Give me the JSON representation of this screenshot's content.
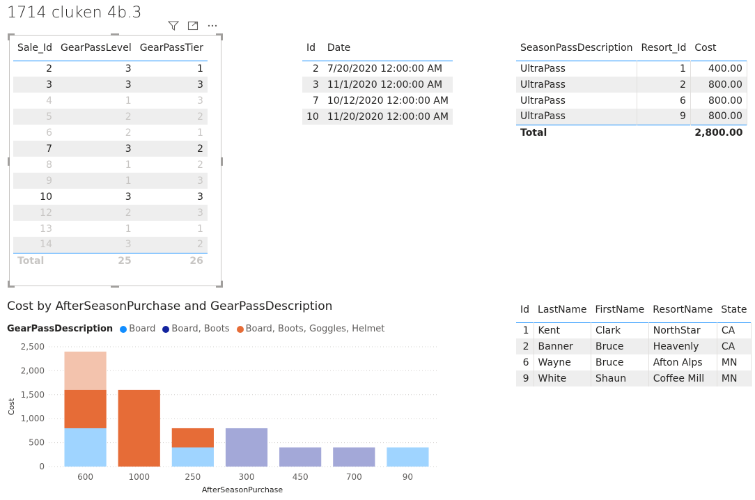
{
  "page_title": "1714 cluken 4b.3",
  "visual_header": {
    "filter_icon": "filter-icon",
    "focus_icon": "focus-mode-icon",
    "more_icon": "more-options-icon"
  },
  "table1": {
    "headers": [
      "Sale_Id",
      "GearPassLevel",
      "GearPassTier"
    ],
    "rows": [
      {
        "c": [
          "2",
          "3",
          "1"
        ],
        "faded": false,
        "stripe": false
      },
      {
        "c": [
          "3",
          "3",
          "3"
        ],
        "faded": false,
        "stripe": true
      },
      {
        "c": [
          "4",
          "1",
          "3"
        ],
        "faded": true,
        "stripe": false
      },
      {
        "c": [
          "5",
          "2",
          "2"
        ],
        "faded": true,
        "stripe": true
      },
      {
        "c": [
          "6",
          "2",
          "1"
        ],
        "faded": true,
        "stripe": false
      },
      {
        "c": [
          "7",
          "3",
          "2"
        ],
        "faded": false,
        "stripe": true
      },
      {
        "c": [
          "8",
          "1",
          "2"
        ],
        "faded": true,
        "stripe": false
      },
      {
        "c": [
          "9",
          "1",
          "3"
        ],
        "faded": true,
        "stripe": true
      },
      {
        "c": [
          "10",
          "3",
          "3"
        ],
        "faded": false,
        "stripe": false
      },
      {
        "c": [
          "12",
          "2",
          "3"
        ],
        "faded": true,
        "stripe": true
      },
      {
        "c": [
          "13",
          "1",
          "1"
        ],
        "faded": true,
        "stripe": false
      },
      {
        "c": [
          "14",
          "3",
          "2"
        ],
        "faded": true,
        "stripe": true
      }
    ],
    "total": [
      "Total",
      "25",
      "26"
    ]
  },
  "table2": {
    "headers": [
      "Id",
      "Date"
    ],
    "rows": [
      [
        "2",
        "7/20/2020 12:00:00 AM"
      ],
      [
        "3",
        "11/1/2020 12:00:00 AM"
      ],
      [
        "7",
        "10/12/2020 12:00:00 AM"
      ],
      [
        "10",
        "11/20/2020 12:00:00 AM"
      ]
    ]
  },
  "table3": {
    "headers": [
      "SeasonPassDescription",
      "Resort_Id",
      "Cost"
    ],
    "rows": [
      [
        "UltraPass",
        "1",
        "400.00"
      ],
      [
        "UltraPass",
        "2",
        "800.00"
      ],
      [
        "UltraPass",
        "6",
        "800.00"
      ],
      [
        "UltraPass",
        "9",
        "800.00"
      ]
    ],
    "total": [
      "Total",
      "",
      "2,800.00"
    ]
  },
  "table4": {
    "headers": [
      "Id",
      "LastName",
      "FirstName",
      "ResortName",
      "State"
    ],
    "rows": [
      [
        "1",
        "Kent",
        "Clark",
        "NorthStar",
        "CA"
      ],
      [
        "2",
        "Banner",
        "Bruce",
        "Heavenly",
        "CA"
      ],
      [
        "6",
        "Wayne",
        "Bruce",
        "Afton Alps",
        "MN"
      ],
      [
        "9",
        "White",
        "Shaun",
        "Coffee Mill",
        "MN"
      ]
    ]
  },
  "chart_data": {
    "type": "bar",
    "title": "Cost by AfterSeasonPurchase and GearPassDescription",
    "xlabel": "AfterSeasonPurchase",
    "ylabel": "Cost",
    "ylim": [
      0,
      2500
    ],
    "yticks": [
      "0",
      "500",
      "1,000",
      "1,500",
      "2,000",
      "2,500"
    ],
    "legend_title": "GearPassDescription",
    "categories": [
      "600",
      "1000",
      "250",
      "300",
      "450",
      "700",
      "90"
    ],
    "series": [
      {
        "name": "Board",
        "color": "#118dff",
        "values": [
          800,
          0,
          400,
          0,
          0,
          0,
          400
        ]
      },
      {
        "name": "Board, Boots",
        "color": "#12239e",
        "values": [
          0,
          0,
          0,
          800,
          400,
          400,
          0
        ]
      },
      {
        "name": "Board, Boots, Goggles, Helmet",
        "color": "#e66c37",
        "values": [
          1600,
          1600,
          400,
          0,
          0,
          0,
          0
        ]
      }
    ],
    "highlight_values": [
      [
        800,
        0,
        400,
        0,
        0,
        0,
        400
      ],
      [
        0,
        0,
        0,
        800,
        400,
        400,
        0
      ],
      [
        800,
        1600,
        400,
        0,
        0,
        0,
        0
      ]
    ]
  }
}
